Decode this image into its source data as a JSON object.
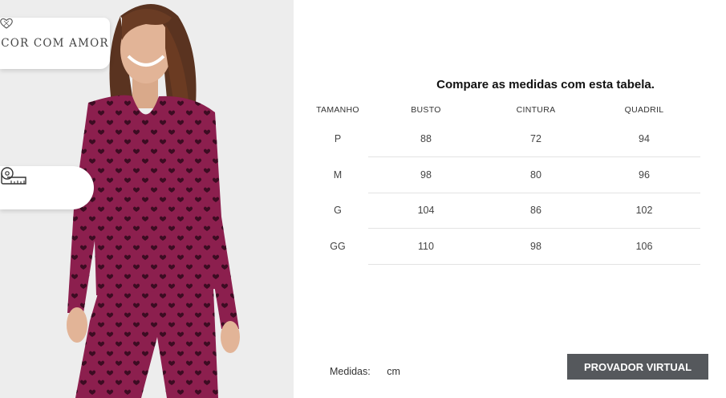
{
  "brand": {
    "name": "COR COM AMOR",
    "logo_icon": "heart-logo-icon"
  },
  "tape_button": {
    "icon": "measuring-tape-icon"
  },
  "size_chart": {
    "title": "Compare as medidas com esta tabela.",
    "headers": [
      "TAMANHO",
      "BUSTO",
      "CINTURA",
      "QUADRIL"
    ],
    "rows": [
      [
        "P",
        "88",
        "72",
        "94"
      ],
      [
        "M",
        "98",
        "80",
        "96"
      ],
      [
        "G",
        "104",
        "86",
        "102"
      ],
      [
        "GG",
        "110",
        "98",
        "106"
      ]
    ]
  },
  "units": {
    "label": "Medidas:",
    "value": "cm"
  },
  "virtual_fitting_button": {
    "label": "PROVADOR VIRTUAL"
  },
  "colors": {
    "garment": "#8c1f4e",
    "button": "#55585c",
    "background": "#ededed"
  }
}
